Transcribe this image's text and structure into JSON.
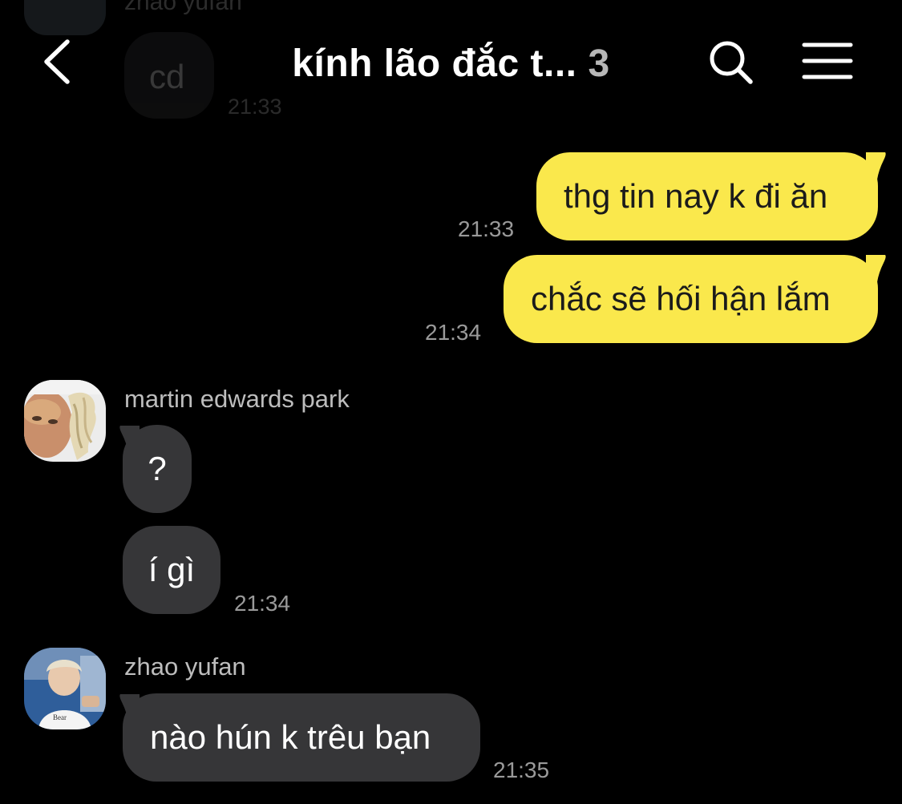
{
  "header": {
    "title": "kính lão đắc t...",
    "member_count": "3",
    "back_icon": "chevron-left-icon",
    "search_icon": "search-icon",
    "menu_icon": "hamburger-menu-icon"
  },
  "previous_message": {
    "sender": "zhao yufan",
    "text": "cd",
    "time": "21:33"
  },
  "messages_out": [
    {
      "text": "thg tin nay k đi ăn",
      "time": "21:33"
    },
    {
      "text": "chắc sẽ hối hận lắm",
      "time": "21:34"
    }
  ],
  "group_martin": {
    "sender": "martin edwards park",
    "messages": [
      {
        "text": "?"
      },
      {
        "text": "í gì",
        "time": "21:34"
      }
    ]
  },
  "group_zhao": {
    "sender": "zhao yufan",
    "messages": [
      {
        "text": "nào hún k trêu bạn",
        "time": "21:35"
      }
    ]
  },
  "colors": {
    "background": "#000000",
    "outgoing_bubble": "#fae84c",
    "incoming_bubble": "#363638",
    "timestamp": "#9a9a9a"
  }
}
